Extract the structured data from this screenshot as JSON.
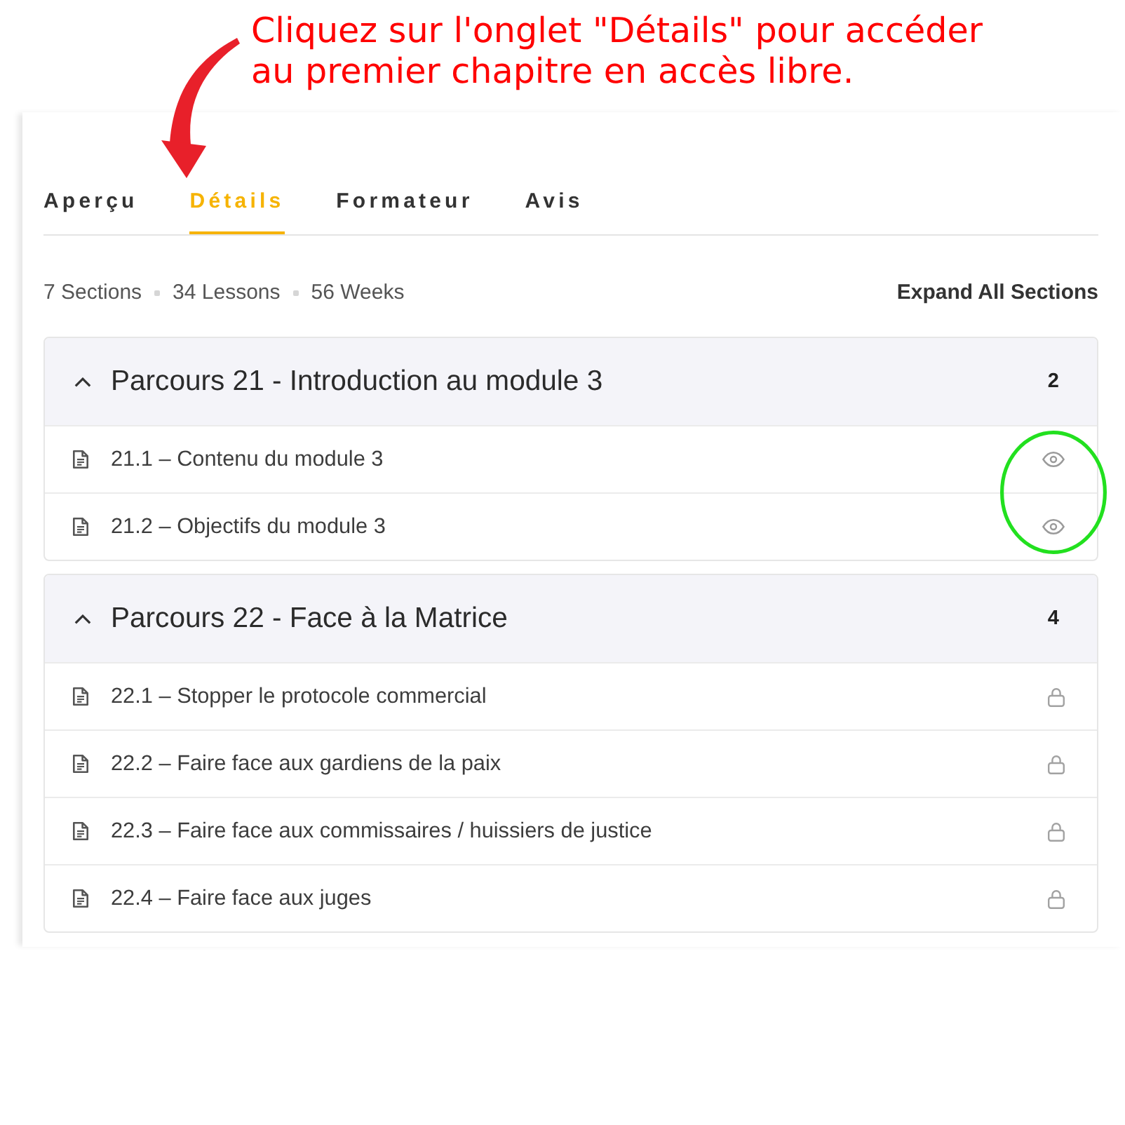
{
  "annotation": {
    "text": "Cliquez sur l'onglet \"Détails\" pour accéder au premier chapitre en accès libre."
  },
  "tabs": [
    {
      "label": "Aperçu",
      "selected": false
    },
    {
      "label": "Détails",
      "selected": true
    },
    {
      "label": "Formateur",
      "selected": false
    },
    {
      "label": "Avis",
      "selected": false
    }
  ],
  "summary": {
    "items": [
      "7 Sections",
      "34 Lessons",
      "56 Weeks"
    ],
    "expand_all": "Expand All Sections"
  },
  "sections": [
    {
      "title": "Parcours 21 - Introduction au module 3",
      "count": "2",
      "expanded": true,
      "lessons": [
        {
          "title": "21.1 – Contenu du module 3",
          "locked": false
        },
        {
          "title": "21.2 – Objectifs du module 3",
          "locked": false
        }
      ]
    },
    {
      "title": "Parcours 22 - Face à la Matrice",
      "count": "4",
      "expanded": true,
      "lessons": [
        {
          "title": "22.1 – Stopper le protocole commercial",
          "locked": true
        },
        {
          "title": "22.2 – Faire face aux gardiens de la paix",
          "locked": true
        },
        {
          "title": "22.3 – Faire face aux commissaires / huissiers de justice",
          "locked": true
        },
        {
          "title": "22.4 – Faire face aux juges",
          "locked": true
        }
      ]
    }
  ]
}
